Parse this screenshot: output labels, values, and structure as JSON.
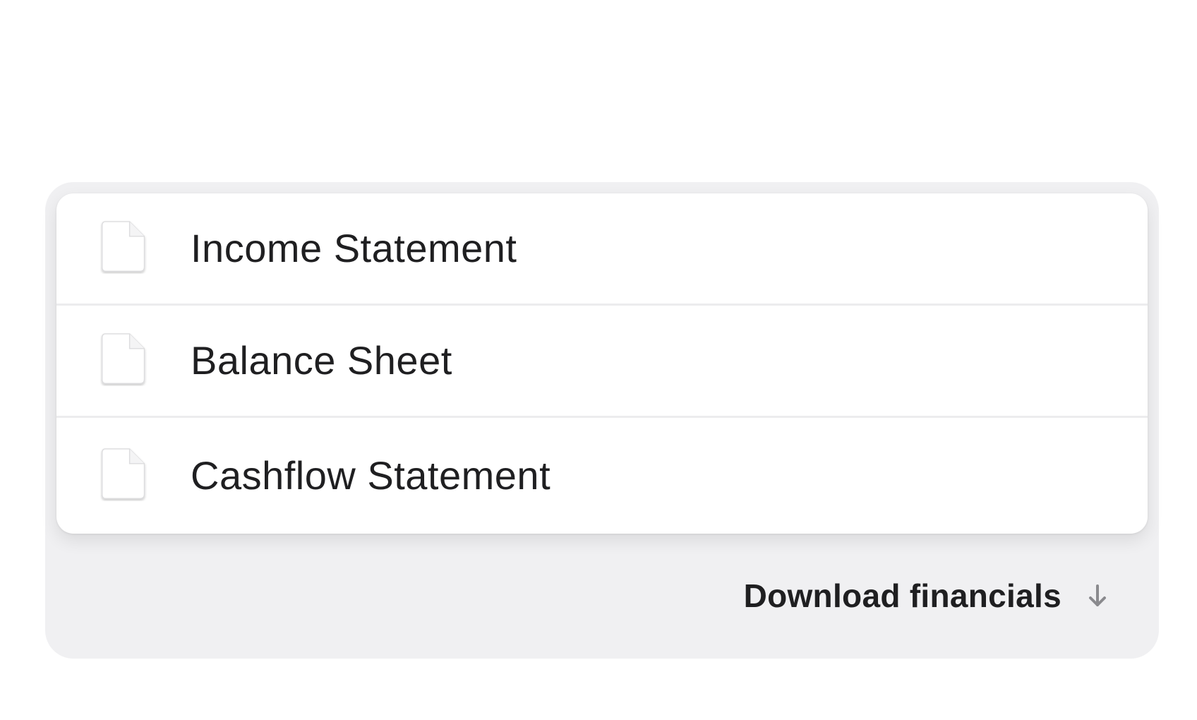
{
  "files": {
    "items": [
      {
        "label": "Income Statement",
        "icon": "document-icon"
      },
      {
        "label": "Balance Sheet",
        "icon": "document-icon"
      },
      {
        "label": "Cashflow Statement",
        "icon": "document-icon"
      }
    ]
  },
  "footer": {
    "download_label": "Download financials",
    "download_icon": "arrow-down-icon"
  },
  "colors": {
    "outer_background": "#f0f0f2",
    "list_background": "#ffffff",
    "text": "#1f1f21",
    "icon_gray": "#8a8a8e"
  }
}
